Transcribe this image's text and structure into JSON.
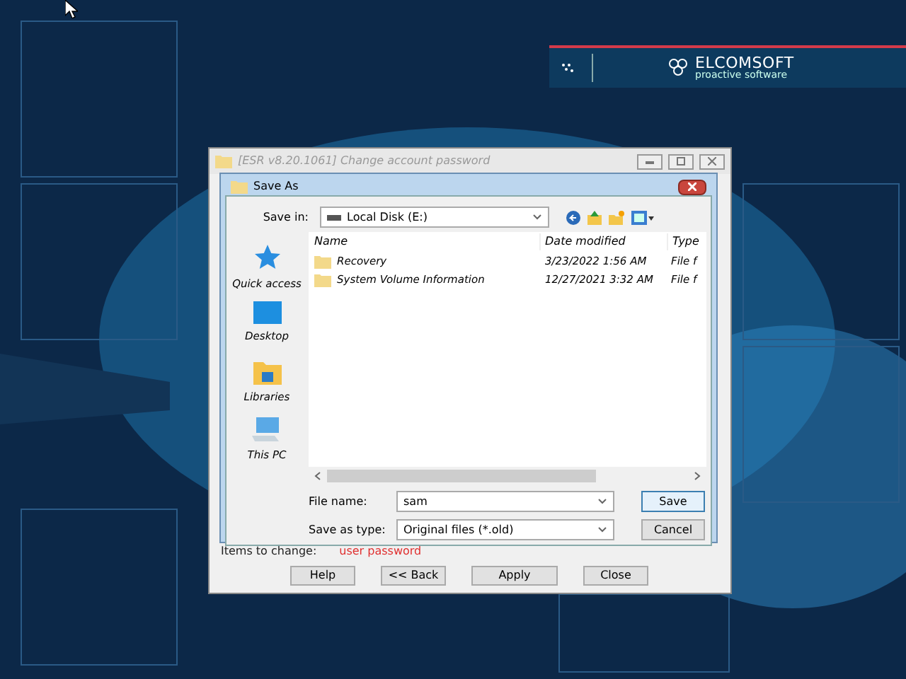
{
  "banner": {
    "brand": "ELCOMSOFT",
    "tagline": "proactive software"
  },
  "window": {
    "title": "[ESR v8.20.1061]  Change account password"
  },
  "dialog": {
    "title": "Save As",
    "save_in": {
      "label": "Save in:",
      "value": "Local Disk (E:)"
    },
    "places": [
      {
        "kind": "star",
        "label": "Quick access"
      },
      {
        "kind": "desktop",
        "label": "Desktop"
      },
      {
        "kind": "libraries",
        "label": "Libraries"
      },
      {
        "kind": "pc",
        "label": "This PC"
      }
    ],
    "columns": [
      "Name",
      "Date modified",
      "Type"
    ],
    "rows": [
      {
        "name": "Recovery",
        "date": "3/23/2022 1:56 AM",
        "type": "File f"
      },
      {
        "name": "System Volume Information",
        "date": "12/27/2021 3:32 AM",
        "type": "File f"
      }
    ],
    "file_name": {
      "label": "File name:",
      "value": "sam"
    },
    "save_as_type": {
      "label": "Save as type:",
      "value": "Original files (*.old)"
    },
    "buttons": [
      "Save",
      "Cancel"
    ]
  },
  "items_to_change": {
    "label": "Items to change:",
    "value": "user password"
  },
  "buttons": [
    "Help",
    "<< Back",
    "Apply",
    "Close"
  ]
}
